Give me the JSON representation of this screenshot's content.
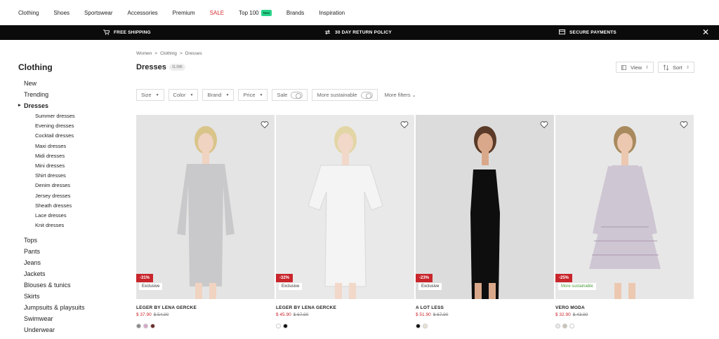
{
  "topnav": {
    "items": [
      "Clothing",
      "Shoes",
      "Sportswear",
      "Accessories",
      "Premium",
      "SALE",
      "Top 100",
      "Brands",
      "Inspiration"
    ],
    "new_badge": "New"
  },
  "banner": {
    "shipping": "FREE SHIPPING",
    "returns": "30 DAY RETURN POLICY",
    "payments": "SECURE PAYMENTS",
    "close": "✕"
  },
  "sidebar": {
    "title": "Clothing",
    "top_items": [
      "New",
      "Trending"
    ],
    "active": "Dresses",
    "sub_items": [
      "Summer dresses",
      "Evening dresses",
      "Cocktail dresses",
      "Maxi dresses",
      "Midi dresses",
      "Mini dresses",
      "Shirt dresses",
      "Denim dresses",
      "Jersey dresses",
      "Sheath dresses",
      "Lace dresses",
      "Knit dresses"
    ],
    "bottom_items": [
      "Tops",
      "Pants",
      "Jeans",
      "Jackets",
      "Blouses & tunics",
      "Skirts",
      "Jumpsuits & playsuits",
      "Swimwear",
      "Underwear"
    ]
  },
  "breadcrumb": [
    "Women",
    "Clothing",
    "Dresses"
  ],
  "breadcrumb_sep": ">",
  "page": {
    "title": "Dresses",
    "count": "11,586"
  },
  "toolbar": {
    "view": "View",
    "sort": "Sort"
  },
  "filters": {
    "dropdowns": [
      "Size",
      "Color",
      "Brand",
      "Price"
    ],
    "sale": "Sale",
    "sustainable": "More sustainable",
    "more": "More filters"
  },
  "products": [
    {
      "brand": "LEGER BY LENA GERCKE",
      "price": "$ 37.90",
      "old_price": "$ 54.90",
      "discount": "-31%",
      "tag": "Exclusive",
      "dress_color": "#c9c9cb",
      "bg": "#e4e4e4",
      "swatches": [
        "#888888",
        "#d9a6c9",
        "#6b2a24"
      ]
    },
    {
      "brand": "LEGER BY LENA GERCKE",
      "price": "$ 45.90",
      "old_price": "$ 67.90",
      "discount": "-32%",
      "tag": "Exclusive",
      "dress_color": "#f4f4f4",
      "bg": "#e9e9e9",
      "swatches": [
        "#ffffff",
        "#111111"
      ]
    },
    {
      "brand": "A LOT LESS",
      "price": "$ 51.90",
      "old_price": "$ 67.90",
      "discount": "-23%",
      "tag": "Exclusive",
      "dress_color": "#0e0e0e",
      "bg": "#dcdcdc",
      "swatches": [
        "#111111",
        "#e8e4d6"
      ]
    },
    {
      "brand": "VERO MODA",
      "price": "$ 32.90",
      "old_price": "$ 43.90",
      "discount": "-25%",
      "tag": "More sustainable",
      "dress_color": "#cfc6d3",
      "bg": "#e7e7e7",
      "swatches": [
        "#ece8ec",
        "#c9c4b6",
        "#ffffff"
      ]
    }
  ]
}
